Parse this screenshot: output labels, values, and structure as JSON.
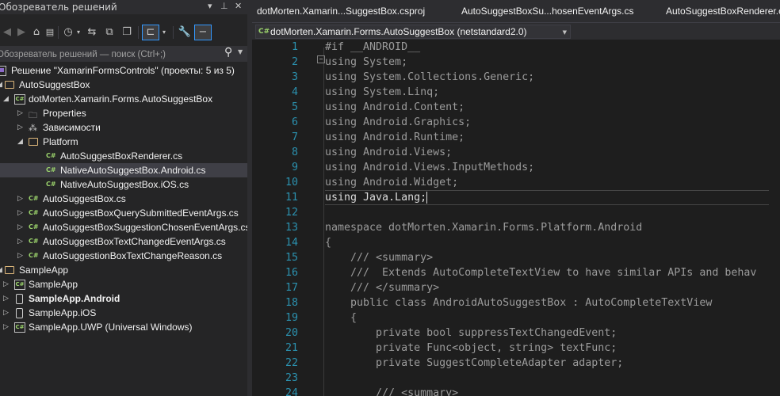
{
  "solution_explorer": {
    "title": "Обозреватель решений",
    "pin": "⊐",
    "close": "✕",
    "search_placeholder": "Обозреватель решений — поиск (Ctrl+;)",
    "tree": [
      {
        "label": "Решение \"XamarinFormsControls\" (проекты: 5 из 5)",
        "icon": "solution-icon",
        "indent": 0,
        "arrow": ""
      },
      {
        "label": "AutoSuggestBox",
        "icon": "folder-open-icon",
        "indent": 0,
        "arrow": "◢"
      },
      {
        "label": "dotMorten.Xamarin.Forms.AutoSuggestBox",
        "icon": "csharp-project-icon",
        "indent": 1,
        "arrow": "◢"
      },
      {
        "label": "Properties",
        "icon": "properties-icon",
        "indent": 2,
        "arrow": "▷"
      },
      {
        "label": "Зависимости",
        "icon": "dependencies-icon",
        "indent": 2,
        "arrow": "▷"
      },
      {
        "label": "Platform",
        "icon": "folder-open-icon",
        "indent": 2,
        "arrow": "◢"
      },
      {
        "label": "AutoSuggestBoxRenderer.cs",
        "icon": "csharp-file-icon",
        "indent": 3,
        "arrow": ""
      },
      {
        "label": "NativeAutoSuggestBox.Android.cs",
        "icon": "csharp-file-icon",
        "indent": 3,
        "arrow": "",
        "selected": true
      },
      {
        "label": "NativeAutoSuggestBox.iOS.cs",
        "icon": "csharp-file-icon",
        "indent": 3,
        "arrow": ""
      },
      {
        "label": "AutoSuggestBox.cs",
        "icon": "csharp-file-icon",
        "indent": 2,
        "arrow": "▷"
      },
      {
        "label": "AutoSuggestBoxQuerySubmittedEventArgs.cs",
        "icon": "csharp-file-icon",
        "indent": 2,
        "arrow": "▷"
      },
      {
        "label": "AutoSuggestBoxSuggestionChosenEventArgs.cs",
        "icon": "csharp-file-icon",
        "indent": 2,
        "arrow": "▷"
      },
      {
        "label": "AutoSuggestBoxTextChangedEventArgs.cs",
        "icon": "csharp-file-icon",
        "indent": 2,
        "arrow": "▷"
      },
      {
        "label": "AutoSuggestionBoxTextChangeReason.cs",
        "icon": "csharp-file-icon",
        "indent": 2,
        "arrow": "▷"
      },
      {
        "label": "SampleApp",
        "icon": "folder-open-icon",
        "indent": 0,
        "arrow": "◢"
      },
      {
        "label": "SampleApp",
        "icon": "csharp-project-icon",
        "indent": 1,
        "arrow": "▷"
      },
      {
        "label": "SampleApp.Android",
        "icon": "android-project-icon",
        "indent": 1,
        "arrow": "▷",
        "bold": true
      },
      {
        "label": "SampleApp.iOS",
        "icon": "ios-project-icon",
        "indent": 1,
        "arrow": "▷"
      },
      {
        "label": "SampleApp.UWP (Universal Windows)",
        "icon": "csharp-project-icon",
        "indent": 1,
        "arrow": "▷"
      }
    ]
  },
  "editor": {
    "tabs": [
      {
        "label": "dotMorten.Xamarin...SuggestBox.csproj"
      },
      {
        "label": "AutoSuggestBoxSu...hosenEventArgs.cs"
      },
      {
        "label": "AutoSuggestBoxRenderer.cs"
      }
    ],
    "project_combo": "dotMorten.Xamarin.Forms.AutoSuggestBox (netstandard2.0)",
    "lines": [
      {
        "n": "1",
        "text": "#if __ANDROID__",
        "style": "dim"
      },
      {
        "n": "2",
        "text": "using System;",
        "style": "dim"
      },
      {
        "n": "3",
        "text": "using System.Collections.Generic;",
        "style": "dim"
      },
      {
        "n": "4",
        "text": "using System.Linq;",
        "style": "dim"
      },
      {
        "n": "5",
        "text": "using Android.Content;",
        "style": "dim"
      },
      {
        "n": "6",
        "text": "using Android.Graphics;",
        "style": "dim"
      },
      {
        "n": "7",
        "text": "using Android.Runtime;",
        "style": "dim"
      },
      {
        "n": "8",
        "text": "using Android.Views;",
        "style": "dim"
      },
      {
        "n": "9",
        "text": "using Android.Views.InputMethods;",
        "style": "dim"
      },
      {
        "n": "10",
        "text": "using Android.Widget;",
        "style": "dim"
      },
      {
        "n": "11",
        "text": "using Java.Lang;",
        "style": "cur"
      },
      {
        "n": "12",
        "text": "",
        "style": "dim"
      },
      {
        "n": "13",
        "text": "namespace dotMorten.Xamarin.Forms.Platform.Android",
        "style": "dim"
      },
      {
        "n": "14",
        "text": "{",
        "style": "dim"
      },
      {
        "n": "15",
        "text": "    /// <summary>",
        "style": "dim"
      },
      {
        "n": "16",
        "text": "    ///  Extends AutoCompleteTextView to have similar APIs and behav",
        "style": "dim"
      },
      {
        "n": "17",
        "text": "    /// </summary>",
        "style": "dim"
      },
      {
        "n": "18",
        "text": "    public class AndroidAutoSuggestBox : AutoCompleteTextView",
        "style": "dim"
      },
      {
        "n": "19",
        "text": "    {",
        "style": "dim"
      },
      {
        "n": "20",
        "text": "        private bool suppressTextChangedEvent;",
        "style": "dim"
      },
      {
        "n": "21",
        "text": "        private Func<object, string> textFunc;",
        "style": "dim"
      },
      {
        "n": "22",
        "text": "        private SuggestCompleteAdapter adapter;",
        "style": "dim"
      },
      {
        "n": "23",
        "text": "",
        "style": "dim"
      },
      {
        "n": "24",
        "text": "        /// <summary>",
        "style": "dim"
      }
    ]
  }
}
